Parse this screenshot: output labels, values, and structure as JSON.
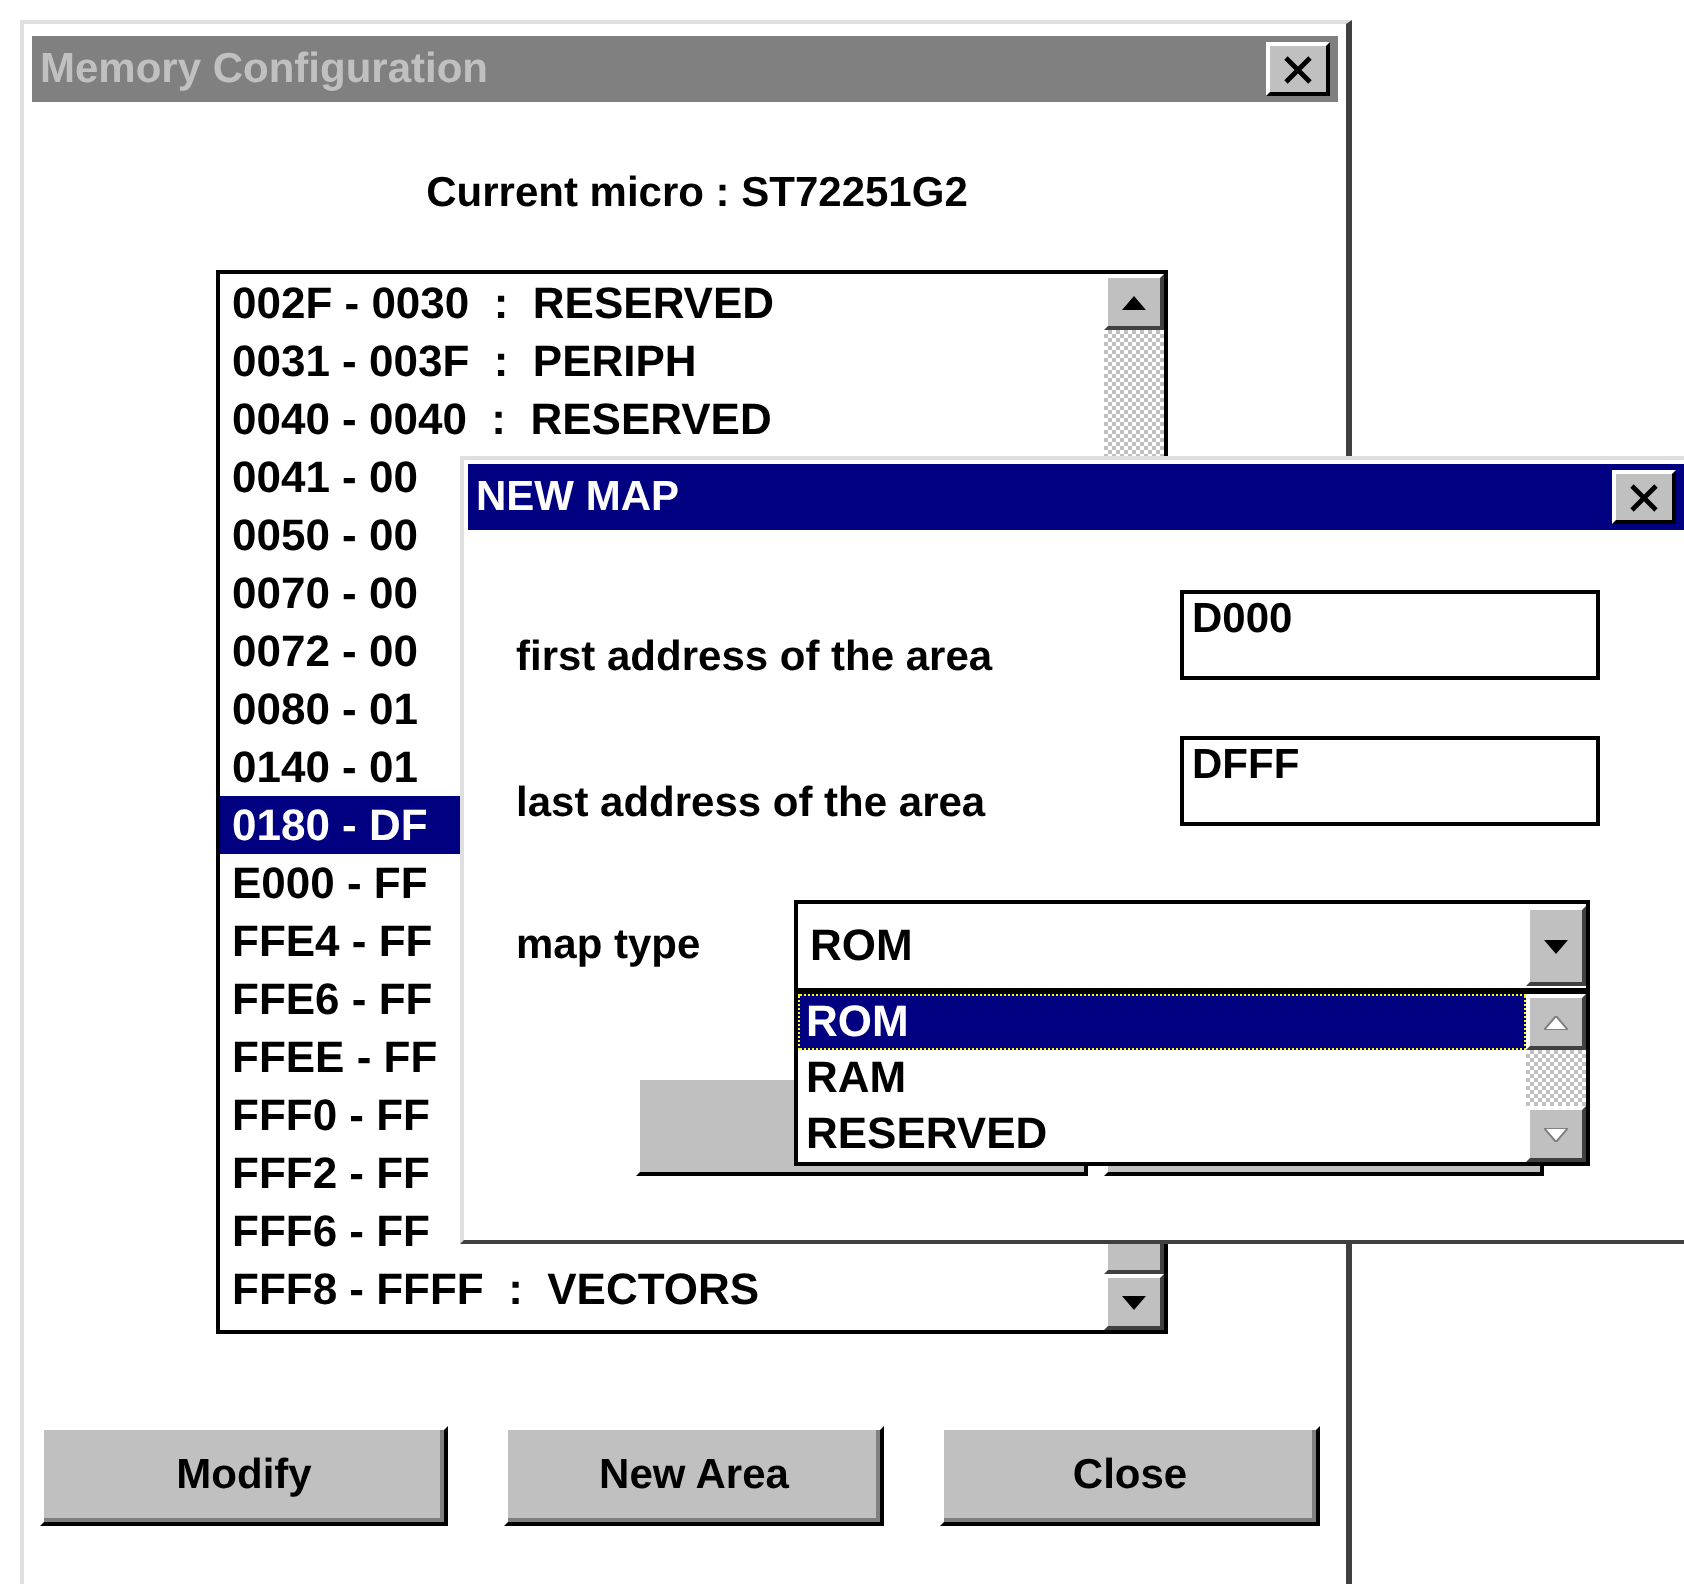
{
  "main_window": {
    "title": "Memory Configuration",
    "active": false,
    "current_micro": "Current micro : ST72251G2",
    "areas": [
      {
        "text": "002F - 0030  :  RESERVED",
        "selected": false
      },
      {
        "text": "0031 - 003F  :  PERIPH",
        "selected": false
      },
      {
        "text": "0040 - 0040  :  RESERVED",
        "selected": false
      },
      {
        "text": "0041 - 00",
        "selected": false
      },
      {
        "text": "0050 - 00",
        "selected": false
      },
      {
        "text": "0070 - 00",
        "selected": false
      },
      {
        "text": "0072 - 00",
        "selected": false
      },
      {
        "text": "0080 - 01",
        "selected": false
      },
      {
        "text": "0140 - 01",
        "selected": false
      },
      {
        "text": "0180 - DF",
        "selected": true
      },
      {
        "text": "E000 - FF",
        "selected": false
      },
      {
        "text": "FFE4 - FF",
        "selected": false
      },
      {
        "text": "FFE6 - FF",
        "selected": false
      },
      {
        "text": "FFEE - FF",
        "selected": false
      },
      {
        "text": "FFF0 - FF",
        "selected": false
      },
      {
        "text": "FFF2 - FF",
        "selected": false
      },
      {
        "text": "FFF6 - FF",
        "selected": false
      },
      {
        "text": "FFF8 - FFFF  :  VECTORS",
        "selected": false
      }
    ],
    "buttons": [
      "Modify",
      "New Area",
      "Close"
    ]
  },
  "new_map_dialog": {
    "title": "NEW MAP",
    "active": true,
    "fields": [
      {
        "label": "first address of the area",
        "value": "D000"
      },
      {
        "label": "last address of the area",
        "value": "DFFF"
      }
    ],
    "map_type": {
      "label": "map type",
      "value": "ROM",
      "expanded": true,
      "options": [
        {
          "label": "ROM",
          "selected": true
        },
        {
          "label": "RAM",
          "selected": false
        },
        {
          "label": "RESERVED",
          "selected": false
        }
      ]
    }
  }
}
